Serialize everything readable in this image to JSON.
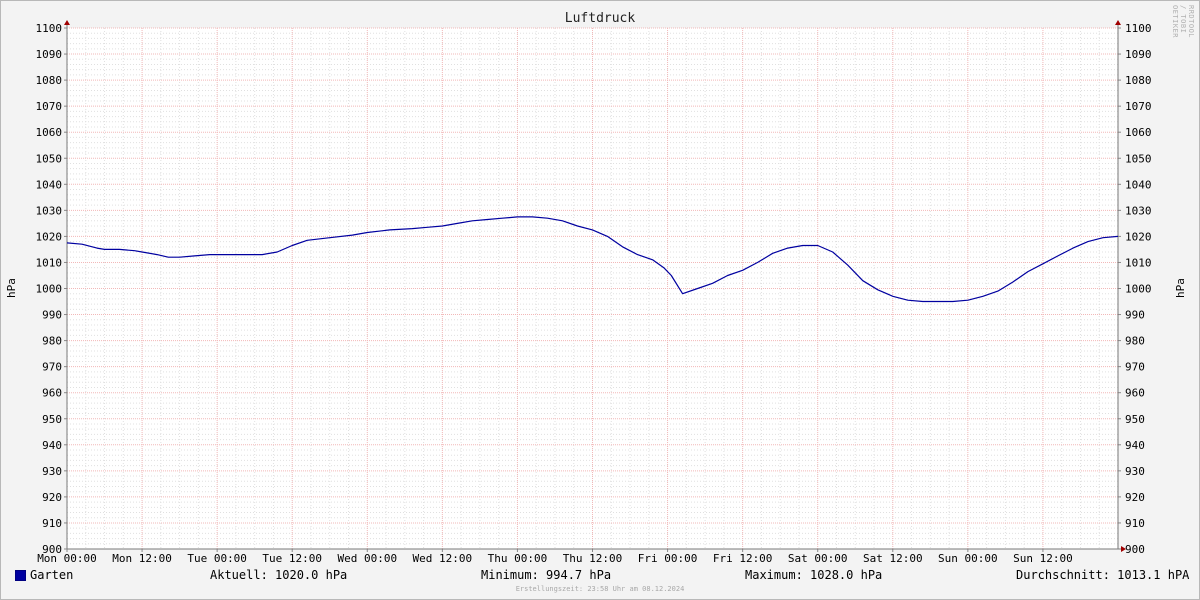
{
  "chart_data": {
    "type": "line",
    "title": "Luftdruck",
    "ylabel": "hPa",
    "ylim": [
      900,
      1100
    ],
    "yticks": [
      900,
      910,
      920,
      930,
      940,
      950,
      960,
      970,
      980,
      990,
      1000,
      1010,
      1020,
      1030,
      1040,
      1050,
      1060,
      1070,
      1080,
      1090,
      1100
    ],
    "xlim": [
      0,
      14
    ],
    "xticks": [
      {
        "x": 0,
        "label": "Mon 00:00"
      },
      {
        "x": 1,
        "label": "Mon 12:00"
      },
      {
        "x": 2,
        "label": "Tue 00:00"
      },
      {
        "x": 3,
        "label": "Tue 12:00"
      },
      {
        "x": 4,
        "label": "Wed 00:00"
      },
      {
        "x": 5,
        "label": "Wed 12:00"
      },
      {
        "x": 6,
        "label": "Thu 00:00"
      },
      {
        "x": 7,
        "label": "Thu 12:00"
      },
      {
        "x": 8,
        "label": "Fri 00:00"
      },
      {
        "x": 9,
        "label": "Fri 12:00"
      },
      {
        "x": 10,
        "label": "Sat 00:00"
      },
      {
        "x": 11,
        "label": "Sat 12:00"
      },
      {
        "x": 12,
        "label": "Sun 00:00"
      },
      {
        "x": 13,
        "label": "Sun 12:00"
      }
    ],
    "grid": true,
    "series": [
      {
        "name": "Garten",
        "color": "#0000a0",
        "x": [
          0,
          0.2,
          0.4,
          0.5,
          0.7,
          0.9,
          1.0,
          1.2,
          1.35,
          1.5,
          1.7,
          1.9,
          2.0,
          2.3,
          2.6,
          2.8,
          3.0,
          3.2,
          3.5,
          3.8,
          4.0,
          4.3,
          4.6,
          4.8,
          5.0,
          5.2,
          5.4,
          5.6,
          5.8,
          6.0,
          6.2,
          6.4,
          6.6,
          6.8,
          7.0,
          7.2,
          7.4,
          7.6,
          7.8,
          7.95,
          8.05,
          8.2,
          8.4,
          8.6,
          8.8,
          9.0,
          9.2,
          9.4,
          9.6,
          9.8,
          10.0,
          10.2,
          10.4,
          10.6,
          10.8,
          11.0,
          11.2,
          11.4,
          11.6,
          11.8,
          12.0,
          12.2,
          12.4,
          12.6,
          12.8,
          13.0,
          13.2,
          13.4,
          13.6,
          13.8,
          14.0
        ],
        "values": [
          1017.5,
          1017,
          1015.5,
          1015,
          1015,
          1014.5,
          1014,
          1013,
          1012,
          1012,
          1012.5,
          1013,
          1013,
          1013,
          1013,
          1014,
          1016.5,
          1018.5,
          1019.5,
          1020.5,
          1021.5,
          1022.5,
          1023,
          1023.5,
          1024,
          1025,
          1026,
          1026.5,
          1027,
          1027.5,
          1027.5,
          1027,
          1026,
          1024,
          1022.5,
          1020,
          1016,
          1013,
          1011,
          1008,
          1005,
          998,
          1000,
          1002,
          1005,
          1007,
          1010,
          1013.5,
          1015.5,
          1016.5,
          1016.5,
          1014,
          1009,
          1003,
          999.5,
          997,
          995.5,
          995,
          995,
          995,
          995.5,
          997,
          999,
          1002.5,
          1006.5,
          1009.5,
          1012.5,
          1015.5,
          1018,
          1019.5,
          1020
        ]
      }
    ],
    "legend": "bottom-left"
  },
  "footer": {
    "legend_label": "Garten",
    "aktuell": "Aktuell: 1020.0 hPa",
    "minimum": "Minimum: 994.7 hPa",
    "maximum": "Maximum: 1028.0 hPa",
    "durchschnitt": "Durchschnitt: 1013.1 hPA",
    "created": "Erstellungszeit: 23:58 Uhr am 08.12.2024"
  },
  "watermark": "RRDTOOL / TOBI OETIKER",
  "colors": {
    "background": "#f3f3f3",
    "plot_background": "#ffffff",
    "grid_minor": "#e0e0e0",
    "grid_major": "#f2b8b8",
    "line": "#0000a0",
    "axis_arrow": "#a00000"
  }
}
